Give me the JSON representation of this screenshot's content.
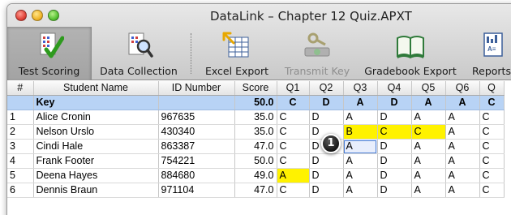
{
  "window": {
    "title": "DataLink – Chapter 12 Quiz.APXT"
  },
  "toolbar": {
    "items": [
      {
        "label": "Test Scoring",
        "icon": "test-scoring-icon"
      },
      {
        "label": "Data Collection",
        "icon": "data-collection-icon"
      },
      {
        "label": "Excel Export",
        "icon": "excel-export-icon"
      },
      {
        "label": "Transmit Key",
        "icon": "transmit-key-icon"
      },
      {
        "label": "Gradebook Export",
        "icon": "gradebook-export-icon"
      },
      {
        "label": "Reports",
        "icon": "reports-icon"
      }
    ]
  },
  "table": {
    "headers": [
      "#",
      "Student Name",
      "ID Number",
      "Score",
      "Q1",
      "Q2",
      "Q3",
      "Q4",
      "Q5",
      "Q6",
      "Q"
    ],
    "key_row": {
      "num": "",
      "name": "Key",
      "id": "",
      "score": "50.0",
      "answers": [
        "C",
        "D",
        "A",
        "D",
        "A",
        "A",
        "C"
      ]
    },
    "rows": [
      {
        "num": "1",
        "name": "Alice Cronin",
        "id": "967635",
        "score": "35.0",
        "answers": [
          "C",
          "D",
          "A",
          "D",
          "A",
          "A",
          "C"
        ]
      },
      {
        "num": "2",
        "name": "Nelson Urslo",
        "id": "430340",
        "score": "35.0",
        "answers": [
          "C",
          "D",
          "B",
          "C",
          "C",
          "A",
          "C"
        ]
      },
      {
        "num": "3",
        "name": "Cindi Hale",
        "id": "863387",
        "score": "47.0",
        "answers": [
          "C",
          "D",
          "A",
          "D",
          "A",
          "A",
          "C"
        ]
      },
      {
        "num": "4",
        "name": "Frank Footer",
        "id": "754221",
        "score": "50.0",
        "answers": [
          "C",
          "D",
          "A",
          "D",
          "A",
          "A",
          "C"
        ]
      },
      {
        "num": "5",
        "name": "Deena Hayes",
        "id": "884680",
        "score": "49.0",
        "answers": [
          "A",
          "D",
          "A",
          "D",
          "A",
          "A",
          "C"
        ]
      },
      {
        "num": "6",
        "name": "Dennis Braun",
        "id": "971104",
        "score": "47.0",
        "answers": [
          "C",
          "D",
          "A",
          "D",
          "A",
          "A",
          "C"
        ]
      }
    ]
  },
  "highlight_color": "#fff200",
  "key_row_color": "#b8d3f5",
  "callout": {
    "label": "1"
  }
}
